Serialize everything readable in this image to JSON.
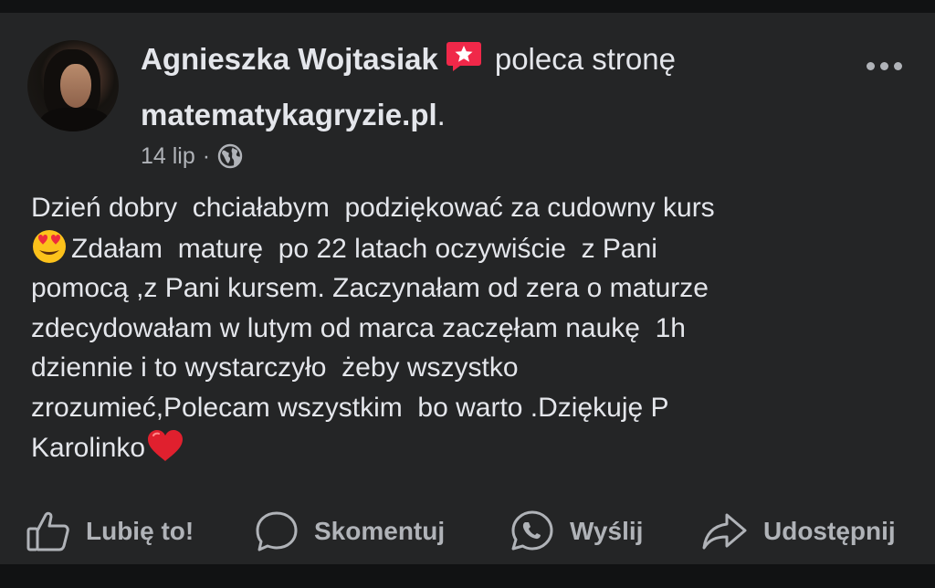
{
  "post": {
    "author": "Agnieszka Wojtasiak",
    "action_text": "poleca stronę",
    "page_name": "matematykagryzie.pl",
    "page_suffix": ".",
    "date": "14 lip",
    "separator": "·",
    "privacy_icon": "globe-icon",
    "badge_icon": "recommendation-star-icon",
    "body_lines": [
      "Dzień dobry  chciałabym  podziękować za cudowny kurs",
      "Zdałam  maturę  po 22 latach oczywiście  z Pani",
      "pomocą ,z Pani kursem. Zaczynałam od zera o maturze",
      "zdecydowałam w lutym od marca zaczęłam naukę  1h",
      "dziennie i to wystarczyło  żeby wszystko",
      "zrozumieć,Polecam wszystkim  bo warto .Dziękuję P",
      "Karolinko"
    ],
    "emojis": [
      "heart-eyes-emoji",
      "red-heart-emoji"
    ]
  },
  "actions": {
    "like_label": "Lubię to!",
    "comment_label": "Skomentuj",
    "send_label": "Wyślij",
    "share_label": "Udostępnij"
  },
  "colors": {
    "background": "#242526",
    "text_primary": "#e4e6eb",
    "text_secondary": "#b0b3b8",
    "badge": "#f02849"
  }
}
